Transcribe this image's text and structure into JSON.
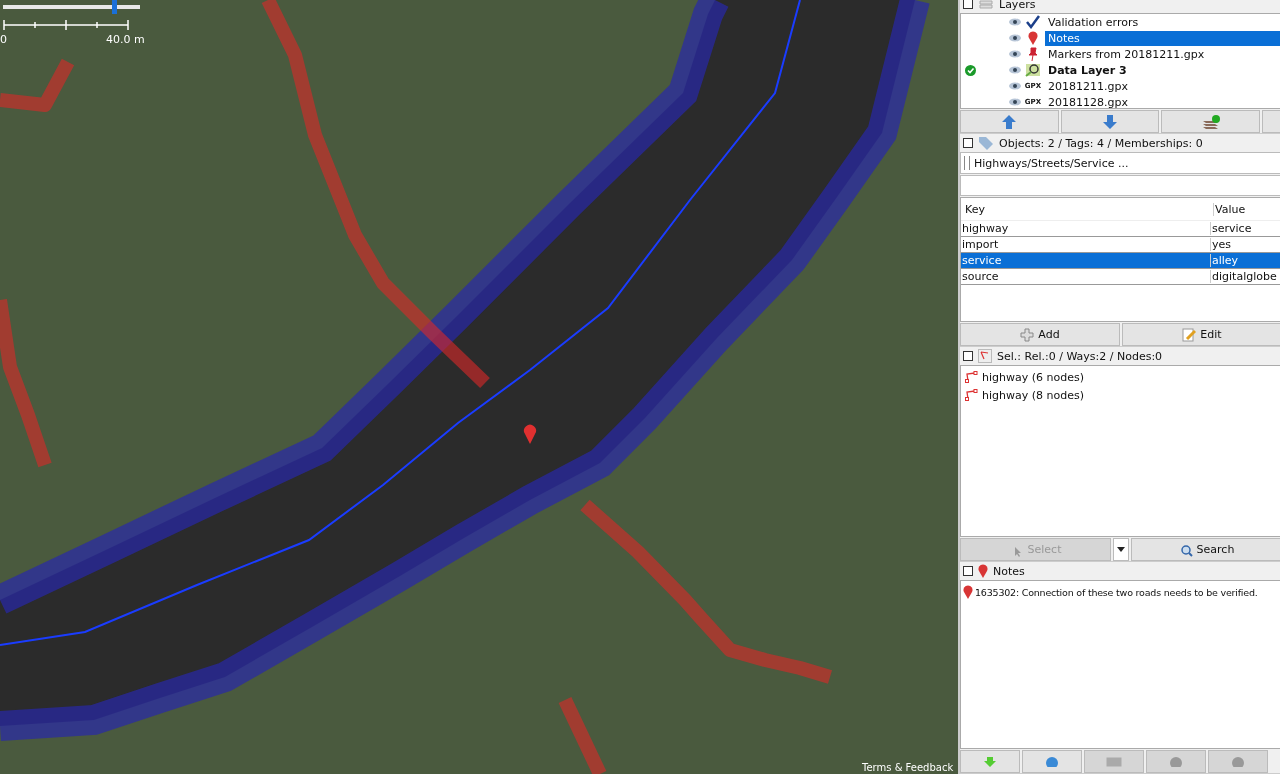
{
  "map": {
    "zoom_slider": {
      "level": 0.82
    },
    "scale": {
      "start": "0",
      "end": "40.0 m"
    },
    "attribution": "Terms & Feedback"
  },
  "layers": {
    "title": "Layers",
    "items": [
      {
        "name": "Validation errors",
        "kind": "validation",
        "selected": false,
        "active": false
      },
      {
        "name": "Notes",
        "kind": "notes",
        "selected": true,
        "active": false
      },
      {
        "name": "Markers from 20181211.gpx",
        "kind": "markers",
        "selected": false,
        "active": false
      },
      {
        "name": "Data Layer 3",
        "kind": "data",
        "selected": false,
        "active": true
      },
      {
        "name": "20181211.gpx",
        "kind": "gpx",
        "icon_text": "GPX",
        "selected": false,
        "active": false
      },
      {
        "name": "20181128.gpx",
        "kind": "gpx",
        "icon_text": "GPX",
        "selected": false,
        "active": false
      }
    ]
  },
  "tags": {
    "title": "Objects: 2 / Tags: 4 / Memberships: 0",
    "preset": "Highways/Streets/Service ...",
    "columns": [
      "Key",
      "Value"
    ],
    "rows": [
      {
        "key": "highway",
        "value": "service",
        "selected": false
      },
      {
        "key": "import",
        "value": "yes",
        "selected": false
      },
      {
        "key": "service",
        "value": "alley",
        "selected": true
      },
      {
        "key": "source",
        "value": "digitalglobe",
        "selected": false
      }
    ],
    "buttons": [
      "Add",
      "Edit"
    ]
  },
  "selection": {
    "title": "Sel.: Rel.:0 / Ways:2 / Nodes:0",
    "items": [
      "highway (6 nodes)",
      "highway (8 nodes)"
    ],
    "buttons": [
      {
        "label": "Select",
        "disabled": true
      },
      {
        "label": "Search",
        "disabled": false
      }
    ]
  },
  "notes": {
    "title": "Notes",
    "items": [
      "1635302: Connection of these two roads needs to be verified."
    ],
    "buttons": [
      {
        "kind": "download",
        "disabled": false
      },
      {
        "kind": "add",
        "disabled": false
      },
      {
        "kind": "comment",
        "disabled": true
      },
      {
        "kind": "close",
        "disabled": true
      },
      {
        "kind": "reopen",
        "disabled": true
      }
    ]
  }
}
